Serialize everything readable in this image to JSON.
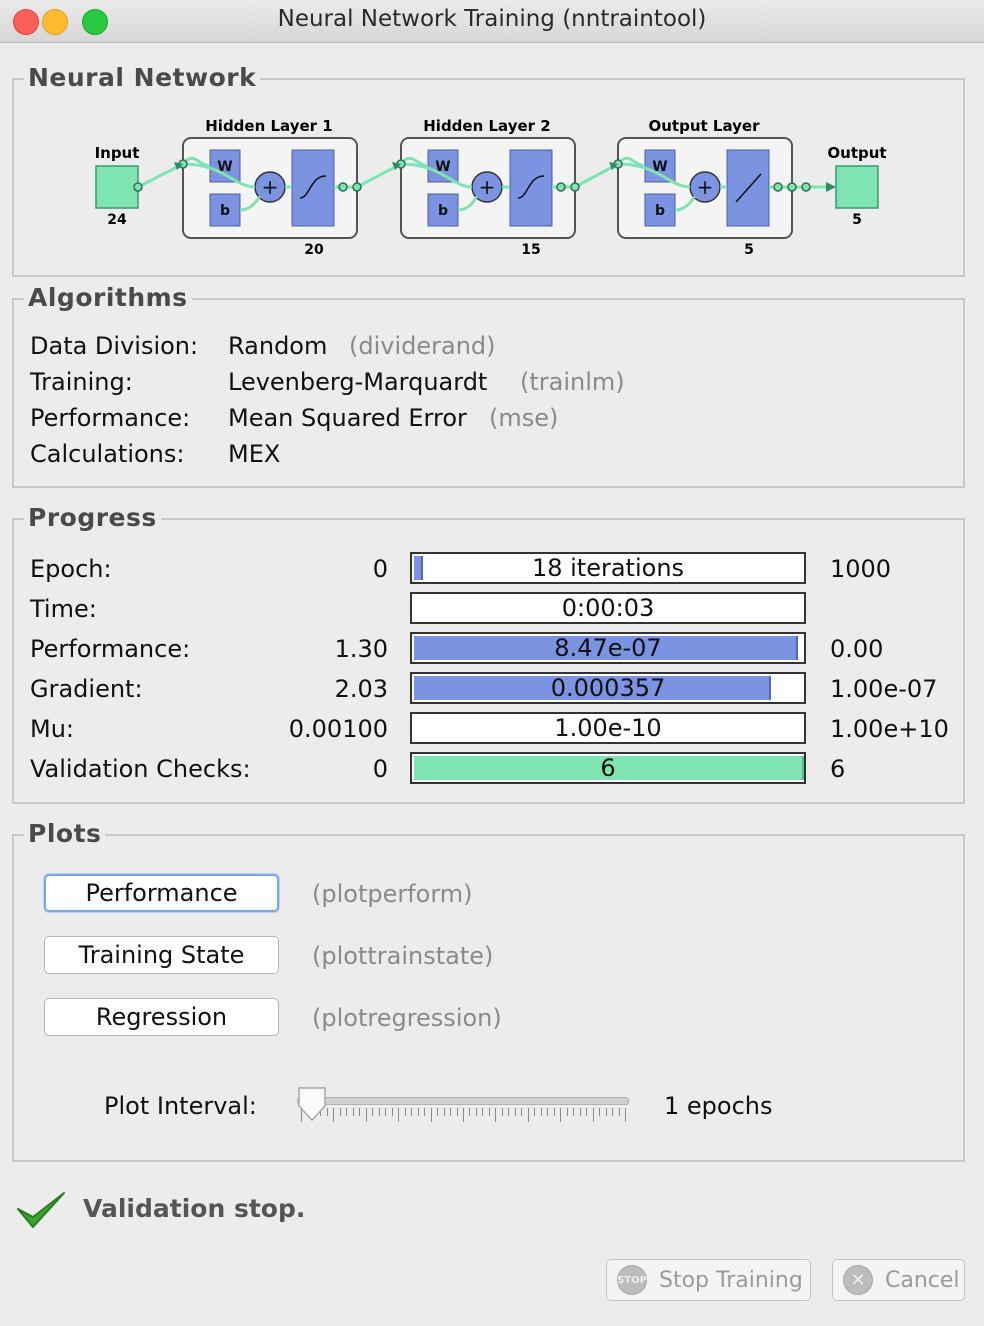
{
  "window": {
    "title": "Neural Network Training (nntraintool)"
  },
  "network": {
    "legend": "Neural Network",
    "input": {
      "label": "Input",
      "size": "24"
    },
    "hidden1": {
      "label": "Hidden Layer 1",
      "size": "20"
    },
    "hidden2": {
      "label": "Hidden Layer 2",
      "size": "15"
    },
    "output_layer": {
      "label": "Output Layer",
      "size": "5"
    },
    "output": {
      "label": "Output",
      "size": "5"
    },
    "weight_label": "W",
    "bias_label": "b",
    "sum_symbol": "+"
  },
  "algorithms": {
    "legend": "Algorithms",
    "rows": [
      {
        "label": "Data Division:",
        "value": "Random",
        "fn": "(dividerand)"
      },
      {
        "label": "Training:",
        "value": "Levenberg-Marquardt",
        "fn": "(trainlm)"
      },
      {
        "label": "Performance:",
        "value": "Mean Squared Error",
        "fn": "(mse)"
      },
      {
        "label": "Calculations:",
        "value": "MEX",
        "fn": ""
      }
    ]
  },
  "progress": {
    "legend": "Progress",
    "rows": [
      {
        "label": "Epoch:",
        "start": "0",
        "current": "18 iterations",
        "end": "1000",
        "fill": 0.018,
        "color": "#7b93e0"
      },
      {
        "label": "Time:",
        "start": "",
        "current": "0:00:03",
        "end": "",
        "fill": 0,
        "color": "#7b93e0"
      },
      {
        "label": "Performance:",
        "start": "1.30",
        "current": "8.47e-07",
        "end": "0.00",
        "fill": 0.985,
        "color": "#7b93e0"
      },
      {
        "label": "Gradient:",
        "start": "2.03",
        "current": "0.000357",
        "end": "1.00e-07",
        "fill": 0.915,
        "color": "#7b93e0"
      },
      {
        "label": "Mu:",
        "start": "0.00100",
        "current": "1.00e-10",
        "end": "1.00e+10",
        "fill": 0,
        "color": "#7b93e0"
      },
      {
        "label": "Validation Checks:",
        "start": "0",
        "current": "6",
        "end": "6",
        "fill": 1.0,
        "color": "#7ee4b1"
      }
    ]
  },
  "plots": {
    "legend": "Plots",
    "buttons": [
      {
        "label": "Performance",
        "fn": "(plotperform)"
      },
      {
        "label": "Training State",
        "fn": "(plottrainstate)"
      },
      {
        "label": "Regression",
        "fn": "(plotregression)"
      }
    ],
    "interval_label": "Plot Interval:",
    "interval_value": "1 epochs",
    "interval_fraction": 0.0
  },
  "status": {
    "text": "Validation stop."
  },
  "footer": {
    "stop_label": "Stop Training",
    "stop_icon_text": "STOP",
    "cancel_label": "Cancel"
  },
  "colors": {
    "accent_blue": "#7b93e0",
    "accent_green": "#7ee4b1"
  }
}
